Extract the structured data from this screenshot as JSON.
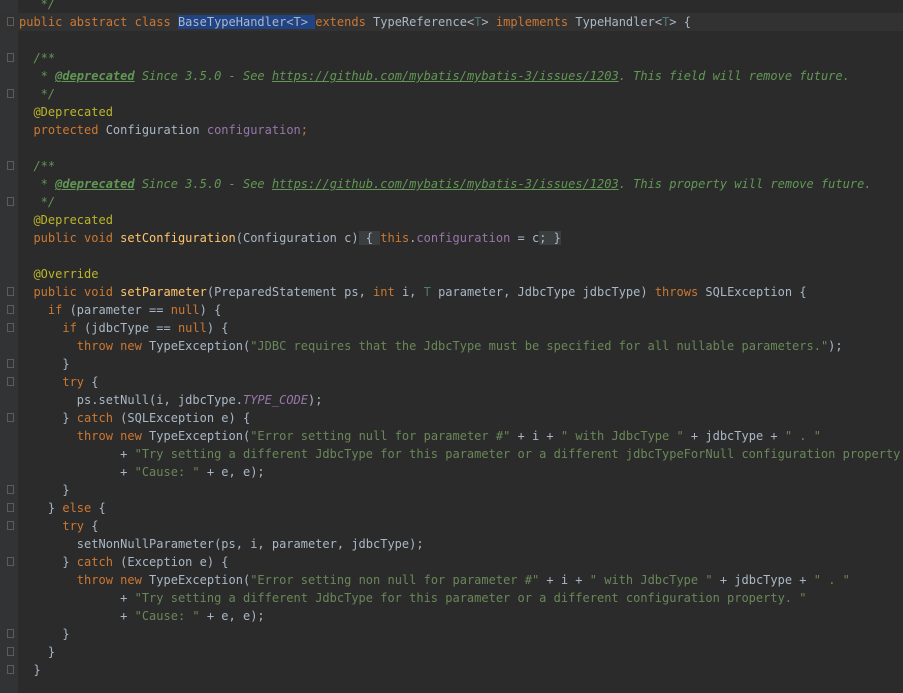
{
  "editor": {
    "language": "Java",
    "lines": [
      {
        "hl": false,
        "fold": false,
        "tokens": [
          {
            "t": "   */",
            "c": "doc"
          }
        ]
      },
      {
        "hl": true,
        "fold": true,
        "tokens": [
          {
            "t": "public abstract class ",
            "c": "kw"
          },
          {
            "t": "BaseTypeHandler<T> ",
            "c": "sel"
          },
          {
            "t": "extends ",
            "c": "kw"
          },
          {
            "t": "TypeReference<",
            "c": "plain"
          },
          {
            "t": "T",
            "c": "type"
          },
          {
            "t": "> ",
            "c": "plain"
          },
          {
            "t": "implements ",
            "c": "kw"
          },
          {
            "t": "TypeHandler<",
            "c": "plain"
          },
          {
            "t": "T",
            "c": "type"
          },
          {
            "t": "> {",
            "c": "plain"
          }
        ]
      },
      {
        "hl": false,
        "fold": false,
        "tokens": []
      },
      {
        "hl": false,
        "fold": true,
        "tokens": [
          {
            "t": "  /**",
            "c": "doc"
          }
        ]
      },
      {
        "hl": false,
        "fold": false,
        "tokens": [
          {
            "t": "   * ",
            "c": "doc"
          },
          {
            "t": "@deprecated",
            "c": "doctag"
          },
          {
            "t": " Since 3.5.0 - See ",
            "c": "doc"
          },
          {
            "t": "https://github.com/mybatis/mybatis-3/issues/1203",
            "c": "link"
          },
          {
            "t": ". This field will remove future.",
            "c": "doc"
          }
        ]
      },
      {
        "hl": false,
        "fold": true,
        "tokens": [
          {
            "t": "   */",
            "c": "doc"
          }
        ]
      },
      {
        "hl": false,
        "fold": false,
        "tokens": [
          {
            "t": "  @Deprecated",
            "c": "anno"
          }
        ]
      },
      {
        "hl": false,
        "fold": false,
        "tokens": [
          {
            "t": "  protected ",
            "c": "kw"
          },
          {
            "t": "Configuration ",
            "c": "plain"
          },
          {
            "t": "configuration",
            "c": "field"
          },
          {
            "t": ";",
            "c": "kw"
          }
        ]
      },
      {
        "hl": false,
        "fold": false,
        "tokens": []
      },
      {
        "hl": false,
        "fold": true,
        "tokens": [
          {
            "t": "  /**",
            "c": "doc"
          }
        ]
      },
      {
        "hl": false,
        "fold": false,
        "tokens": [
          {
            "t": "   * ",
            "c": "doc"
          },
          {
            "t": "@deprecated",
            "c": "doctag"
          },
          {
            "t": " Since 3.5.0 - See ",
            "c": "doc"
          },
          {
            "t": "https://github.com/mybatis/mybatis-3/issues/1203",
            "c": "link"
          },
          {
            "t": ". This property will remove future.",
            "c": "doc"
          }
        ]
      },
      {
        "hl": false,
        "fold": true,
        "tokens": [
          {
            "t": "   */",
            "c": "doc"
          }
        ]
      },
      {
        "hl": false,
        "fold": false,
        "tokens": [
          {
            "t": "  @Deprecated",
            "c": "anno"
          }
        ]
      },
      {
        "hl": false,
        "fold": false,
        "tokens": [
          {
            "t": "  public void ",
            "c": "kw"
          },
          {
            "t": "setConfiguration",
            "c": "fn"
          },
          {
            "t": "(Configuration c)",
            "c": "plain"
          },
          {
            "t": " { ",
            "c": "fold"
          },
          {
            "t": "this",
            "c": "kw"
          },
          {
            "t": ".",
            "c": "plain"
          },
          {
            "t": "configuration",
            "c": "field"
          },
          {
            "t": " = c",
            "c": "plain"
          },
          {
            "t": "; }",
            "c": "fold"
          }
        ]
      },
      {
        "hl": false,
        "fold": false,
        "tokens": []
      },
      {
        "hl": false,
        "fold": false,
        "tokens": [
          {
            "t": "  @Override",
            "c": "anno"
          }
        ]
      },
      {
        "hl": false,
        "fold": true,
        "tokens": [
          {
            "t": "  public void ",
            "c": "kw"
          },
          {
            "t": "setParameter",
            "c": "fn"
          },
          {
            "t": "(PreparedStatement ps, ",
            "c": "plain"
          },
          {
            "t": "int ",
            "c": "kw"
          },
          {
            "t": "i, ",
            "c": "plain"
          },
          {
            "t": "T ",
            "c": "type"
          },
          {
            "t": "parameter, JdbcType jdbcType) ",
            "c": "plain"
          },
          {
            "t": "throws ",
            "c": "kw"
          },
          {
            "t": "SQLException {",
            "c": "plain"
          }
        ]
      },
      {
        "hl": false,
        "fold": true,
        "tokens": [
          {
            "t": "    if ",
            "c": "kw"
          },
          {
            "t": "(parameter == ",
            "c": "plain"
          },
          {
            "t": "null",
            "c": "kw"
          },
          {
            "t": ") {",
            "c": "plain"
          }
        ]
      },
      {
        "hl": false,
        "fold": true,
        "tokens": [
          {
            "t": "      if ",
            "c": "kw"
          },
          {
            "t": "(jdbcType == ",
            "c": "plain"
          },
          {
            "t": "null",
            "c": "kw"
          },
          {
            "t": ") {",
            "c": "plain"
          }
        ]
      },
      {
        "hl": false,
        "fold": false,
        "tokens": [
          {
            "t": "        throw new ",
            "c": "kw"
          },
          {
            "t": "TypeException(",
            "c": "plain"
          },
          {
            "t": "\"JDBC requires that the JdbcType must be specified for all nullable parameters.\"",
            "c": "str"
          },
          {
            "t": ");",
            "c": "plain"
          }
        ]
      },
      {
        "hl": false,
        "fold": true,
        "tokens": [
          {
            "t": "      }",
            "c": "plain"
          }
        ]
      },
      {
        "hl": false,
        "fold": true,
        "tokens": [
          {
            "t": "      try ",
            "c": "kw"
          },
          {
            "t": "{",
            "c": "plain"
          }
        ]
      },
      {
        "hl": false,
        "fold": false,
        "tokens": [
          {
            "t": "        ps.setNull(i, jdbcType.",
            "c": "plain"
          },
          {
            "t": "TYPE_CODE",
            "c": "const"
          },
          {
            "t": ");",
            "c": "plain"
          }
        ]
      },
      {
        "hl": false,
        "fold": true,
        "tokens": [
          {
            "t": "      } ",
            "c": "plain"
          },
          {
            "t": "catch ",
            "c": "kw"
          },
          {
            "t": "(SQLException e) {",
            "c": "plain"
          }
        ]
      },
      {
        "hl": false,
        "fold": false,
        "tokens": [
          {
            "t": "        throw new ",
            "c": "kw"
          },
          {
            "t": "TypeException(",
            "c": "plain"
          },
          {
            "t": "\"Error setting null for parameter #\"",
            "c": "str"
          },
          {
            "t": " + i + ",
            "c": "plain"
          },
          {
            "t": "\" with JdbcType \"",
            "c": "str"
          },
          {
            "t": " + jdbcType + ",
            "c": "plain"
          },
          {
            "t": "\" . \"",
            "c": "str"
          }
        ]
      },
      {
        "hl": false,
        "fold": false,
        "tokens": [
          {
            "t": "              + ",
            "c": "plain"
          },
          {
            "t": "\"Try setting a different JdbcType for this parameter or a different jdbcTypeForNull configuration property. \"",
            "c": "str"
          }
        ]
      },
      {
        "hl": false,
        "fold": false,
        "tokens": [
          {
            "t": "              + ",
            "c": "plain"
          },
          {
            "t": "\"Cause: \"",
            "c": "str"
          },
          {
            "t": " + e, e);",
            "c": "plain"
          }
        ]
      },
      {
        "hl": false,
        "fold": true,
        "tokens": [
          {
            "t": "      }",
            "c": "plain"
          }
        ]
      },
      {
        "hl": false,
        "fold": true,
        "tokens": [
          {
            "t": "    } ",
            "c": "plain"
          },
          {
            "t": "else ",
            "c": "kw"
          },
          {
            "t": "{",
            "c": "plain"
          }
        ]
      },
      {
        "hl": false,
        "fold": true,
        "tokens": [
          {
            "t": "      try ",
            "c": "kw"
          },
          {
            "t": "{",
            "c": "plain"
          }
        ]
      },
      {
        "hl": false,
        "fold": false,
        "tokens": [
          {
            "t": "        setNonNullParameter(ps, i, parameter, jdbcType);",
            "c": "plain"
          }
        ]
      },
      {
        "hl": false,
        "fold": true,
        "tokens": [
          {
            "t": "      } ",
            "c": "plain"
          },
          {
            "t": "catch ",
            "c": "kw"
          },
          {
            "t": "(Exception e) {",
            "c": "plain"
          }
        ]
      },
      {
        "hl": false,
        "fold": false,
        "tokens": [
          {
            "t": "        throw new ",
            "c": "kw"
          },
          {
            "t": "TypeException(",
            "c": "plain"
          },
          {
            "t": "\"Error setting non null for parameter #\"",
            "c": "str"
          },
          {
            "t": " + i + ",
            "c": "plain"
          },
          {
            "t": "\" with JdbcType \"",
            "c": "str"
          },
          {
            "t": " + jdbcType + ",
            "c": "plain"
          },
          {
            "t": "\" . \"",
            "c": "str"
          }
        ]
      },
      {
        "hl": false,
        "fold": false,
        "tokens": [
          {
            "t": "              + ",
            "c": "plain"
          },
          {
            "t": "\"Try setting a different JdbcType for this parameter or a different configuration property. \"",
            "c": "str"
          }
        ]
      },
      {
        "hl": false,
        "fold": false,
        "tokens": [
          {
            "t": "              + ",
            "c": "plain"
          },
          {
            "t": "\"Cause: \"",
            "c": "str"
          },
          {
            "t": " + e, e);",
            "c": "plain"
          }
        ]
      },
      {
        "hl": false,
        "fold": true,
        "tokens": [
          {
            "t": "      }",
            "c": "plain"
          }
        ]
      },
      {
        "hl": false,
        "fold": true,
        "tokens": [
          {
            "t": "    }",
            "c": "plain"
          }
        ]
      },
      {
        "hl": false,
        "fold": true,
        "tokens": [
          {
            "t": "  }",
            "c": "plain"
          }
        ]
      }
    ]
  }
}
